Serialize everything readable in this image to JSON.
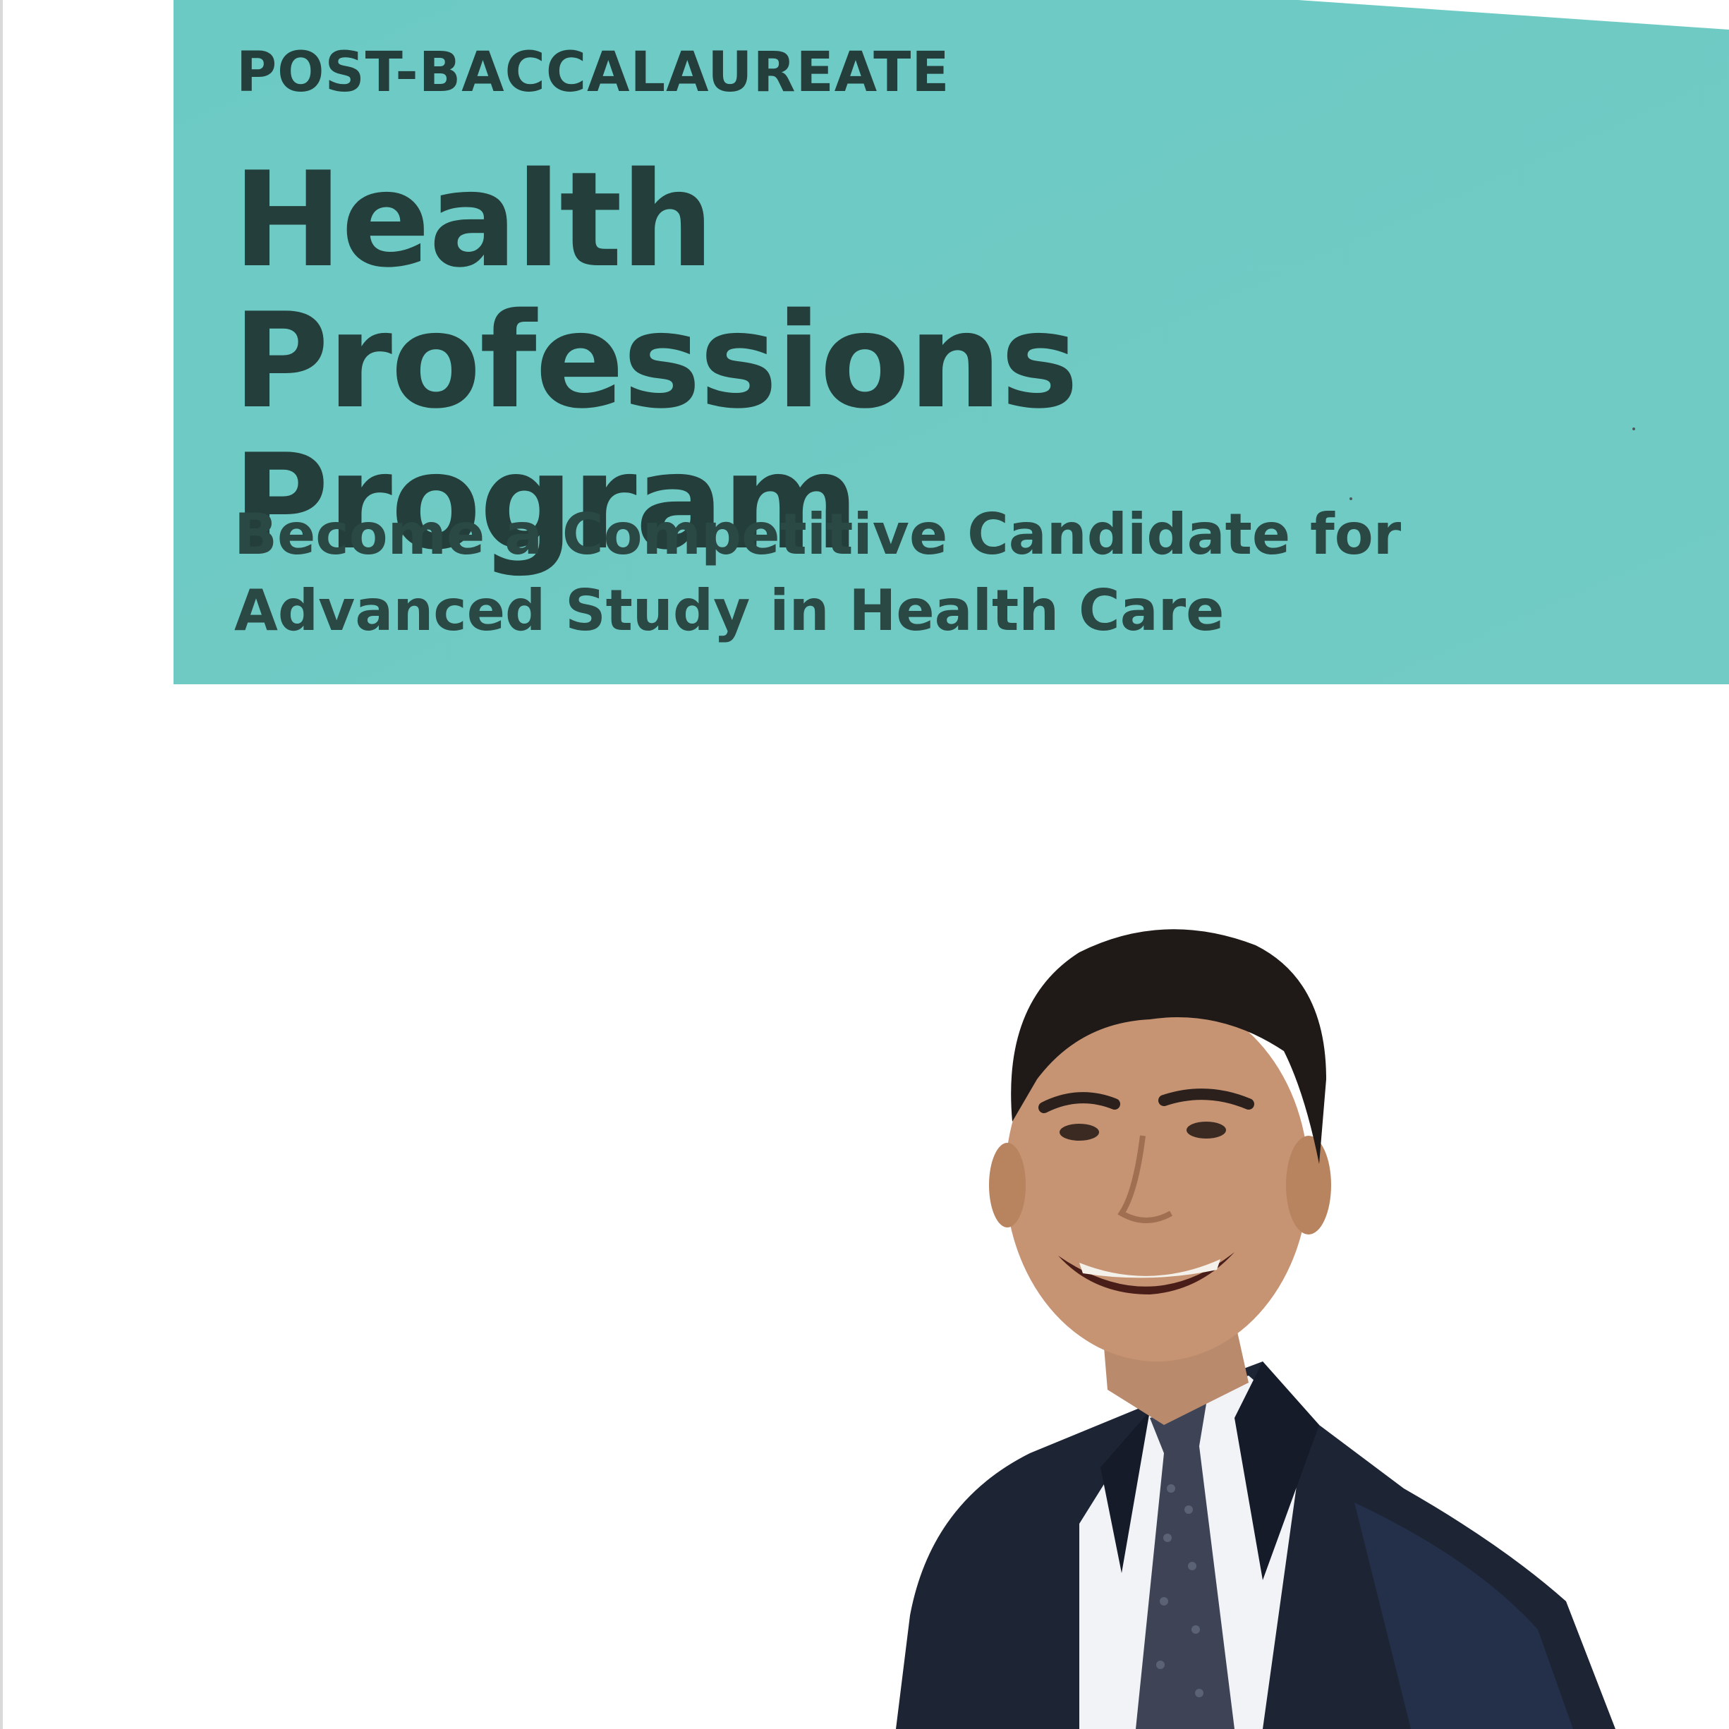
{
  "brochure": {
    "eyebrow": "POST-BACCALAUREATE",
    "title_line1": "Health Professions",
    "title_line2": "Program",
    "subtitle_line1": "Become a Competitive Candidate for",
    "subtitle_line2": "Advanced Study in Health Care"
  },
  "colors": {
    "banner": "#6ec9c3",
    "heading_text": "#243f3b",
    "page_background": "#ffffff"
  }
}
